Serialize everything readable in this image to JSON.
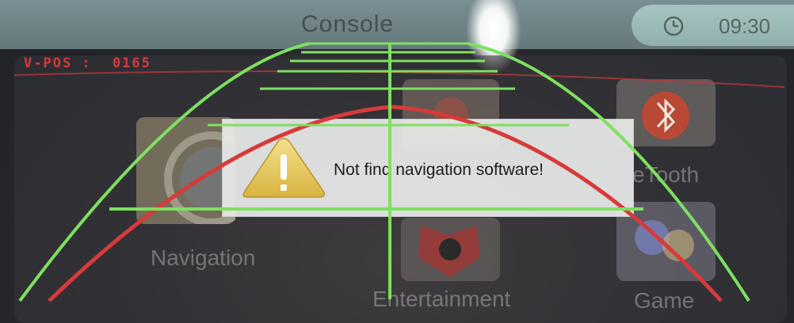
{
  "header": {
    "title": "Console",
    "time": "09:30"
  },
  "camera": {
    "vpos_label": "V-POS :",
    "vpos_value": "0165"
  },
  "apps": [
    {
      "label": "Navigation",
      "icon": "navigation-icon"
    },
    {
      "label": "Entertainment",
      "icon": "entertainment-icon"
    },
    {
      "label": "eTooth",
      "icon": "bluetooth-icon"
    },
    {
      "label": "Game",
      "icon": "game-icon"
    }
  ],
  "dialog": {
    "message": "Not find navigation software!",
    "icon": "warning-icon"
  },
  "colors": {
    "guide_green": "#7ee060",
    "guide_red": "#d83a3a",
    "vpos_red": "#d83a3a"
  }
}
